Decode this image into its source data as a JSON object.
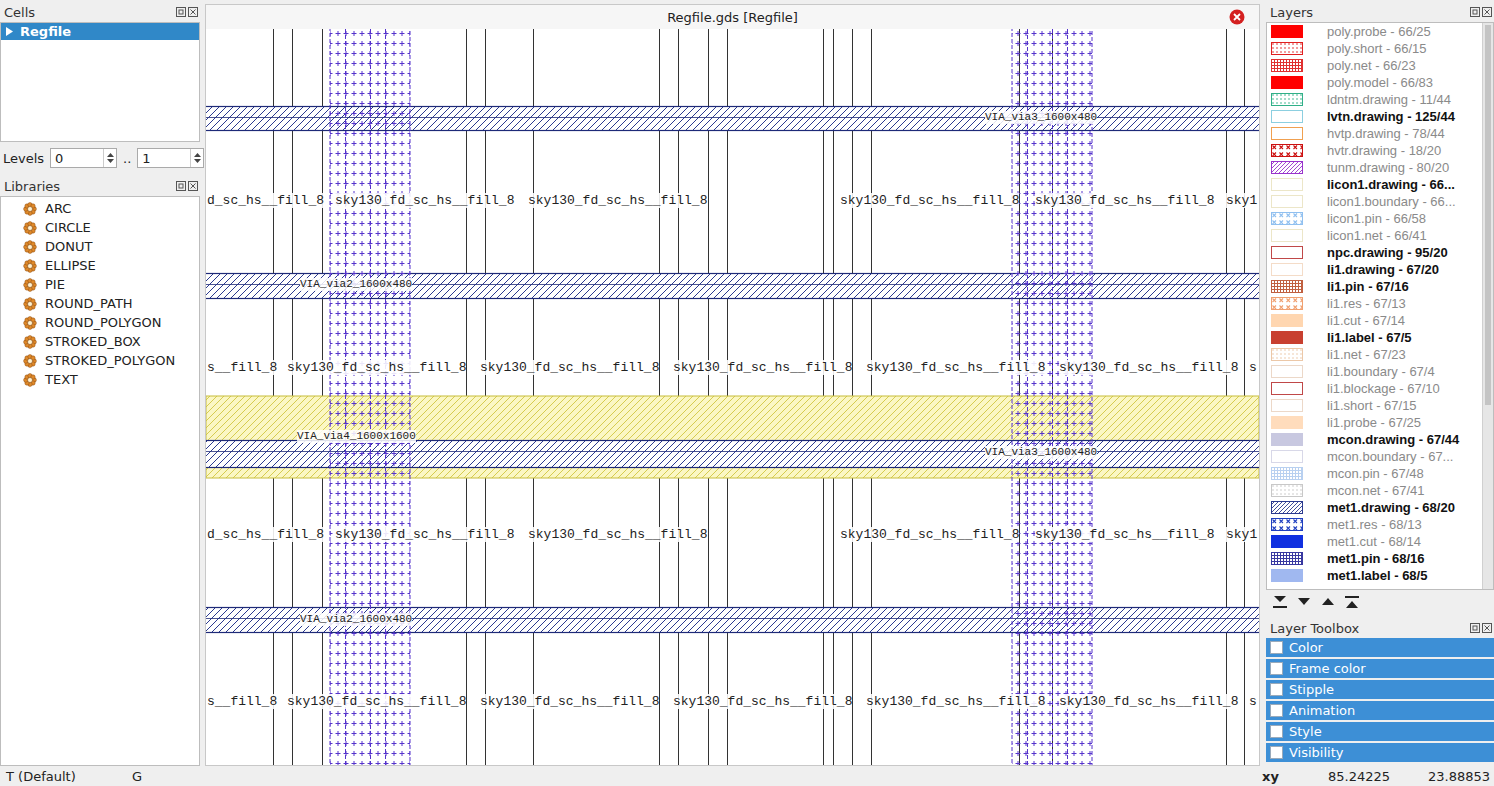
{
  "window": {
    "title": "Regfile.gds [Regfile]"
  },
  "cells_panel": {
    "title": "Cells",
    "items": [
      {
        "label": "Regfile",
        "selected": true,
        "expanded": false
      }
    ]
  },
  "levels": {
    "label": "Levels",
    "from": "0",
    "separator": "..",
    "to": "1"
  },
  "libraries_panel": {
    "title": "Libraries",
    "items": [
      "ARC",
      "CIRCLE",
      "DONUT",
      "ELLIPSE",
      "PIE",
      "ROUND_PATH",
      "ROUND_POLYGON",
      "STROKED_BOX",
      "STROKED_POLYGON",
      "TEXT"
    ]
  },
  "layers_panel": {
    "title": "Layers",
    "items": [
      {
        "label": "poly.probe - 66/25",
        "used": false,
        "color": "#ff0000",
        "kind": "solid"
      },
      {
        "label": "poly.short - 66/15",
        "used": false,
        "color": "#e02020",
        "kind": "dots"
      },
      {
        "label": "poly.net - 66/23",
        "used": false,
        "color": "#e03030",
        "kind": "dense"
      },
      {
        "label": "poly.model - 66/83",
        "used": false,
        "color": "#ff0000",
        "kind": "solid"
      },
      {
        "label": "ldntm.drawing - 11/44",
        "used": false,
        "color": "#30b088",
        "kind": "dots"
      },
      {
        "label": "lvtn.drawing - 125/44",
        "used": true,
        "color": "#8ccfe0",
        "kind": "empty"
      },
      {
        "label": "hvtp.drawing - 78/44",
        "used": false,
        "color": "#f0a050",
        "kind": "empty"
      },
      {
        "label": "hvtr.drawing - 18/20",
        "used": false,
        "color": "#cc1010",
        "kind": "cross"
      },
      {
        "label": "tunm.drawing - 80/20",
        "used": false,
        "color": "#9933cc",
        "kind": "hatch"
      },
      {
        "label": "licon1.drawing - 66...",
        "used": true,
        "color": "#ece6c8",
        "kind": "empty"
      },
      {
        "label": "licon1.boundary - 66...",
        "used": false,
        "color": "#ece6c8",
        "kind": "empty"
      },
      {
        "label": "licon1.pin - 66/58",
        "used": false,
        "color": "#90c0f0",
        "kind": "cross"
      },
      {
        "label": "licon1.net - 66/41",
        "used": false,
        "color": "#ece6c8",
        "kind": "empty"
      },
      {
        "label": "npc.drawing - 95/20",
        "used": true,
        "color": "#c04848",
        "kind": "empty"
      },
      {
        "label": "li1.drawing - 67/20",
        "used": true,
        "color": "#f4dcc8",
        "kind": "empty"
      },
      {
        "label": "li1.pin - 67/16",
        "used": true,
        "color": "#c06040",
        "kind": "dense"
      },
      {
        "label": "li1.res - 67/13",
        "used": false,
        "color": "#f0a070",
        "kind": "cross"
      },
      {
        "label": "li1.cut - 67/14",
        "used": false,
        "color": "#ffd6b0",
        "kind": "solid"
      },
      {
        "label": "li1.label - 67/5",
        "used": true,
        "color": "#c84030",
        "kind": "solid"
      },
      {
        "label": "li1.net - 67/23",
        "used": false,
        "color": "#ecc8a8",
        "kind": "dots"
      },
      {
        "label": "li1.boundary - 67/4",
        "used": false,
        "color": "#ecd8c8",
        "kind": "empty"
      },
      {
        "label": "li1.blockage - 67/10",
        "used": false,
        "color": "#c04848",
        "kind": "empty"
      },
      {
        "label": "li1.short - 67/15",
        "used": false,
        "color": "#ecd8c8",
        "kind": "empty"
      },
      {
        "label": "li1.probe - 67/25",
        "used": false,
        "color": "#ffdcbc",
        "kind": "solid"
      },
      {
        "label": "mcon.drawing - 67/44",
        "used": true,
        "color": "#c8c8e0",
        "kind": "solid"
      },
      {
        "label": "mcon.boundary - 67...",
        "used": false,
        "color": "#d8d8e8",
        "kind": "empty"
      },
      {
        "label": "mcon.pin - 67/48",
        "used": false,
        "color": "#b8d0f0",
        "kind": "dense"
      },
      {
        "label": "mcon.net - 67/41",
        "used": false,
        "color": "#c8c8c8",
        "kind": "dots"
      },
      {
        "label": "met1.drawing - 68/20",
        "used": true,
        "color": "#2b3a8f",
        "kind": "hatch"
      },
      {
        "label": "met1.res - 68/13",
        "used": false,
        "color": "#2040c0",
        "kind": "cross"
      },
      {
        "label": "met1.cut - 68/14",
        "used": false,
        "color": "#1030e0",
        "kind": "solid"
      },
      {
        "label": "met1.pin - 68/16",
        "used": true,
        "color": "#3838a0",
        "kind": "dense"
      },
      {
        "label": "met1.label - 68/5",
        "used": true,
        "color": "#a0b8f0",
        "kind": "solid"
      }
    ]
  },
  "layer_toolbox": {
    "title": "Layer Toolbox",
    "items": [
      {
        "label": "Color",
        "expanded": false
      },
      {
        "label": "Frame color",
        "expanded": false
      },
      {
        "label": "Stipple",
        "expanded": false
      },
      {
        "label": "Animation",
        "expanded": false
      },
      {
        "label": "Style",
        "expanded": false
      },
      {
        "label": "Visibility",
        "expanded": false
      }
    ]
  },
  "canvas": {
    "via_labels": [
      "VIA_via3_1600x480",
      "VIA_via2_1600x480",
      "VIA_via4_1600x1600",
      "VIA_via3_1600x480",
      "VIA_via2_1600x480"
    ],
    "cell_rows": [
      {
        "kind": "a",
        "labels": [
          "d_sc_hs__fill_8",
          "sky130_fd_sc_hs__fill_8",
          "sky130_fd_sc_hs__fill_8",
          "sky130_fd_sc_hs__fill_8",
          "sky130_fd_sc_hs__fill_8",
          "sky1"
        ]
      },
      {
        "kind": "b",
        "labels": [
          "s__fill_8",
          "sky130_fd_sc_hs__fill_8",
          "sky130_fd_sc_hs__fill_8",
          "sky130_fd_sc_hs__fill_8",
          "sky130_fd_sc_hs__fill_8",
          "sky130_fd_sc_hs__fill_8",
          "s"
        ]
      },
      {
        "kind": "a",
        "labels": [
          "d_sc_hs__fill_8",
          "sky130_fd_sc_hs__fill_8",
          "sky130_fd_sc_hs__fill_8",
          "sky130_fd_sc_hs__fill_8",
          "sky130_fd_sc_hs__fill_8",
          "sky1"
        ]
      },
      {
        "kind": "b",
        "labels": [
          "s__fill_8",
          "sky130_fd_sc_hs__fill_8",
          "sky130_fd_sc_hs__fill_8",
          "sky130_fd_sc_hs__fill_8",
          "sky130_fd_sc_hs__fill_8",
          "sky130_fd_sc_hs__fill_8",
          "s"
        ]
      }
    ]
  },
  "status_bar": {
    "mode": "T (Default)",
    "grid": "G",
    "xy_label": "xy",
    "x": "85.24225",
    "y": "23.88853"
  }
}
